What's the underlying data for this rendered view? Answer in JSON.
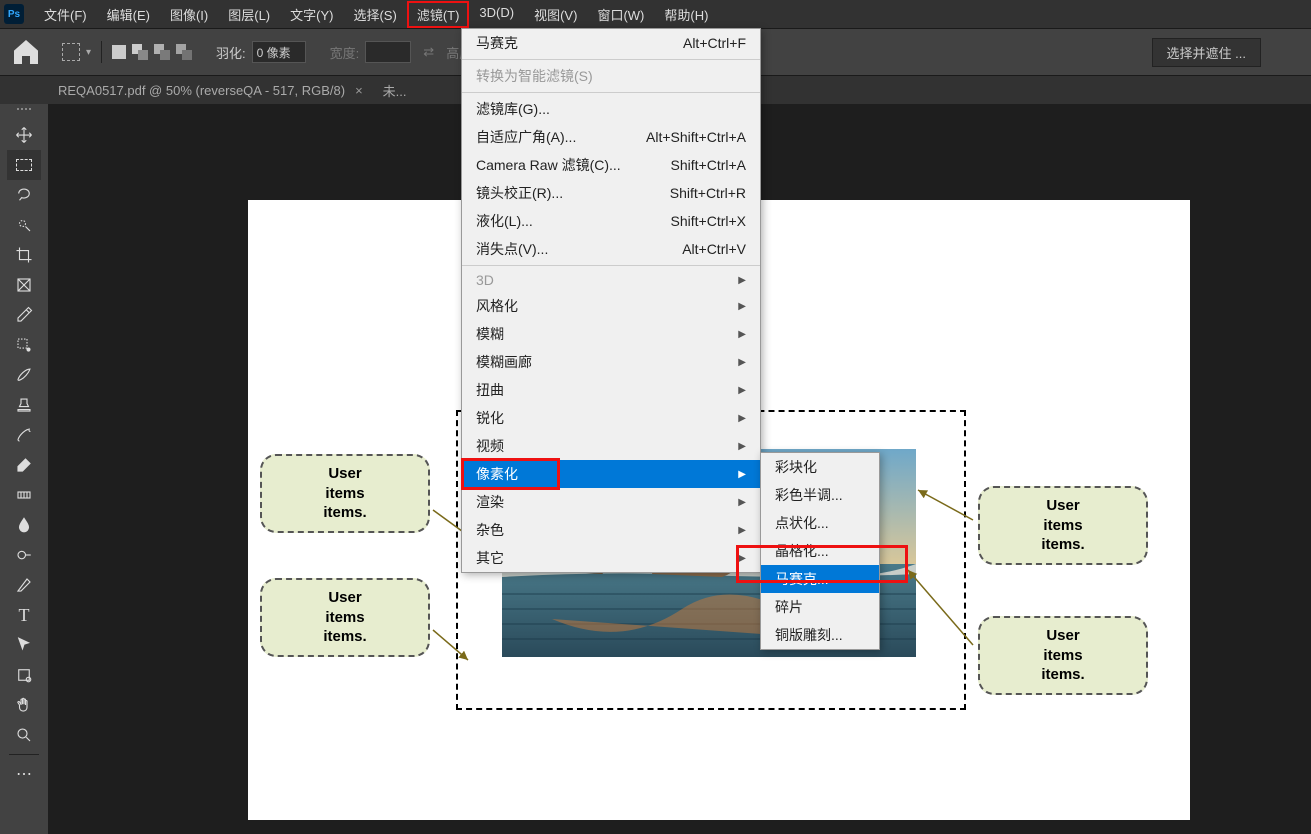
{
  "menubar": {
    "items": [
      "文件(F)",
      "编辑(E)",
      "图像(I)",
      "图层(L)",
      "文字(Y)",
      "选择(S)",
      "滤镜(T)",
      "3D(D)",
      "视图(V)",
      "窗口(W)",
      "帮助(H)"
    ],
    "active_index": 6
  },
  "optionsbar": {
    "feather_label": "羽化:",
    "feather_value": "0 像素",
    "width_label": "宽度:",
    "height_label": "高度:",
    "select_mask": "选择并遮住 ..."
  },
  "tabs": {
    "tab1": "REQA0517.pdf @ 50% (reverseQA - 517, RGB/8)",
    "tab2_prefix": "未..."
  },
  "dropdown": {
    "items": [
      {
        "label": "马赛克",
        "shortcut": "Alt+Ctrl+F",
        "sep_after": true
      },
      {
        "label": "转换为智能滤镜(S)",
        "disabled": true,
        "sep_after": true
      },
      {
        "label": "滤镜库(G)..."
      },
      {
        "label": "自适应广角(A)...",
        "shortcut": "Alt+Shift+Ctrl+A"
      },
      {
        "label": "Camera Raw 滤镜(C)...",
        "shortcut": "Shift+Ctrl+A"
      },
      {
        "label": "镜头校正(R)...",
        "shortcut": "Shift+Ctrl+R"
      },
      {
        "label": "液化(L)...",
        "shortcut": "Shift+Ctrl+X"
      },
      {
        "label": "消失点(V)...",
        "shortcut": "Alt+Ctrl+V",
        "sep_after": true
      },
      {
        "label": "3D",
        "submenu": true,
        "disabled": true
      },
      {
        "label": "风格化",
        "submenu": true
      },
      {
        "label": "模糊",
        "submenu": true
      },
      {
        "label": "模糊画廊",
        "submenu": true
      },
      {
        "label": "扭曲",
        "submenu": true
      },
      {
        "label": "锐化",
        "submenu": true
      },
      {
        "label": "视频",
        "submenu": true
      },
      {
        "label": "像素化",
        "submenu": true,
        "highlight": true,
        "redbox": true
      },
      {
        "label": "渲染",
        "submenu": true
      },
      {
        "label": "杂色",
        "submenu": true
      },
      {
        "label": "其它",
        "submenu": true
      }
    ]
  },
  "submenu": {
    "items": [
      "彩块化",
      "彩色半调...",
      "点状化...",
      "晶格化...",
      "马赛克...",
      "碎片",
      "铜版雕刻..."
    ],
    "highlight_index": 4
  },
  "callouts": {
    "line1": "User",
    "line2": "items",
    "line3": "items."
  }
}
